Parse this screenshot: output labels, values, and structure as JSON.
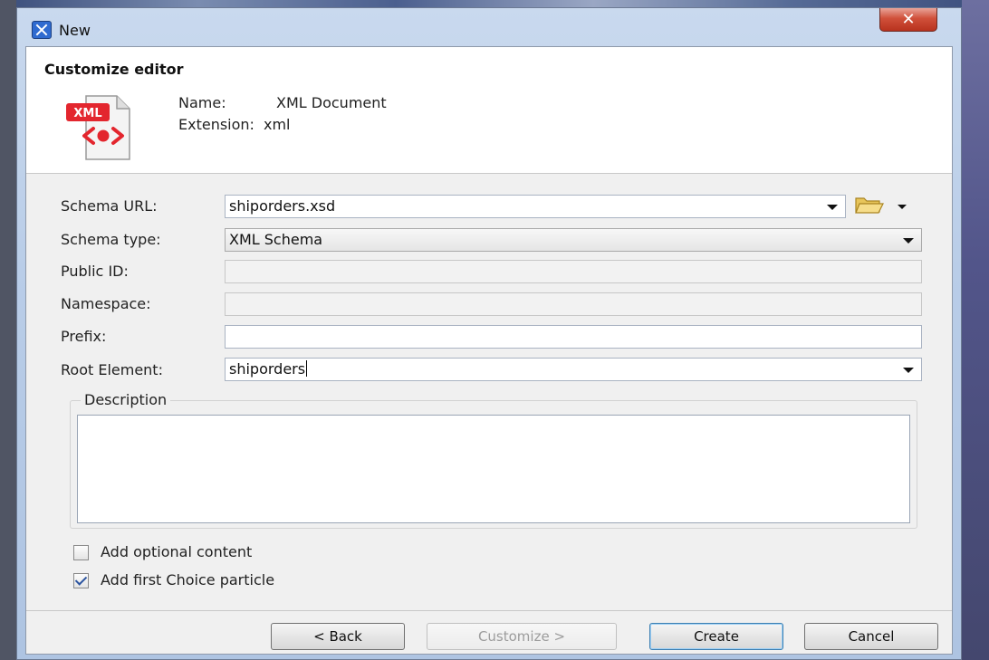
{
  "window": {
    "title": "New",
    "close_glyph": "✕"
  },
  "header": {
    "title": "Customize editor",
    "icon_badge": "XML",
    "name_label": "Name:",
    "name_value": "XML Document",
    "extension_label": "Extension:",
    "extension_value": "xml"
  },
  "form": {
    "schema_url_label": "Schema URL:",
    "schema_url_value": "shiporders.xsd",
    "schema_type_label": "Schema type:",
    "schema_type_value": "XML Schema",
    "public_id_label": "Public ID:",
    "public_id_value": "",
    "namespace_label": "Namespace:",
    "namespace_value": "",
    "prefix_label": "Prefix:",
    "prefix_value": "",
    "root_element_label": "Root Element:",
    "root_element_value": "shiporders"
  },
  "description": {
    "legend": "Description",
    "value": ""
  },
  "options": {
    "add_optional_content_label": "Add optional content",
    "add_optional_content_checked": false,
    "add_first_choice_label": "Add first Choice particle",
    "add_first_choice_checked": true
  },
  "buttons": {
    "back_label": "< Back",
    "customize_label": "Customize >",
    "create_label": "Create",
    "cancel_label": "Cancel"
  },
  "colors": {
    "xml_badge": "#e3262e",
    "title_bar": "#c0d4ec",
    "close_button": "#d0503a"
  },
  "icons": {
    "app": "app-x-icon",
    "document": "xml-document-icon",
    "browse": "folder-open-icon"
  }
}
